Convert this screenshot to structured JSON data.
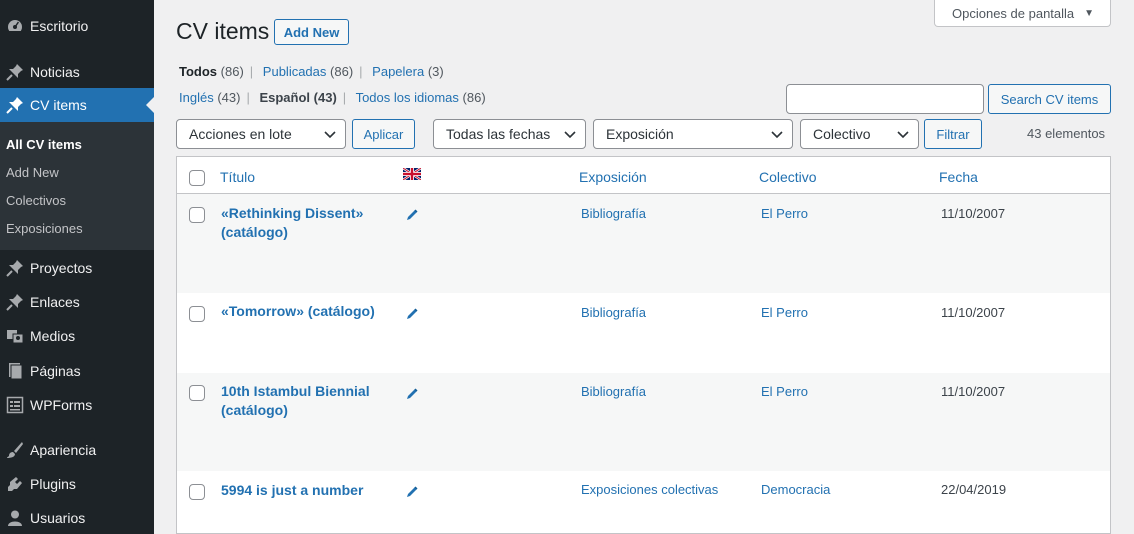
{
  "sidebar": {
    "items": [
      {
        "label": "Escritorio",
        "icon": "dashboard-icon"
      },
      {
        "label": "Noticias",
        "icon": "pin-icon"
      },
      {
        "label": "CV items",
        "icon": "pin-icon"
      },
      {
        "label": "Proyectos",
        "icon": "pin-icon"
      },
      {
        "label": "Enlaces",
        "icon": "pin-icon"
      },
      {
        "label": "Medios",
        "icon": "media-icon"
      },
      {
        "label": "Páginas",
        "icon": "pages-icon"
      },
      {
        "label": "WPForms",
        "icon": "forms-icon"
      },
      {
        "label": "Apariencia",
        "icon": "brush-icon"
      },
      {
        "label": "Plugins",
        "icon": "plugin-icon"
      },
      {
        "label": "Usuarios",
        "icon": "user-icon"
      }
    ],
    "submenu": [
      "All CV items",
      "Add New",
      "Colectivos",
      "Exposiciones"
    ]
  },
  "header": {
    "title": "CV items",
    "add_new": "Add New",
    "screen_options": "Opciones de pantalla"
  },
  "status_filters": [
    {
      "label": "Todos",
      "count": "(86)"
    },
    {
      "label": "Publicadas",
      "count": "(86)"
    },
    {
      "label": "Papelera",
      "count": "(3)"
    }
  ],
  "language_filters": [
    {
      "label": "Inglés",
      "count": "(43)"
    },
    {
      "label": "Español",
      "count": "(43)"
    },
    {
      "label": "Todos los idiomas",
      "count": "(86)"
    }
  ],
  "search": {
    "value": "",
    "button": "Search CV items"
  },
  "bulk": {
    "selected": "Acciones en lote",
    "apply": "Aplicar"
  },
  "filters": {
    "dates": "Todas las fechas",
    "exposicion": "Exposición",
    "colectivo": "Colectivo",
    "button": "Filtrar"
  },
  "items_count": "43 elementos",
  "table": {
    "columns": {
      "title": "Título",
      "exposicion": "Exposición",
      "colectivo": "Colectivo",
      "fecha": "Fecha"
    },
    "rows": [
      {
        "title": "«Rethinking Dissent» (catálogo)",
        "exposicion": "Bibliografía",
        "colectivo": "El Perro",
        "fecha": "11/10/2007"
      },
      {
        "title": "«Tomorrow» (catálogo)",
        "exposicion": "Bibliografía",
        "colectivo": "El Perro",
        "fecha": "11/10/2007"
      },
      {
        "title": "10th Istambul Biennial (catálogo)",
        "exposicion": "Bibliografía",
        "colectivo": "El Perro",
        "fecha": "11/10/2007"
      },
      {
        "title": "5994 is just a number",
        "exposicion": "Exposiciones colectivas",
        "colectivo": "Democracia",
        "fecha": "22/04/2019"
      }
    ]
  },
  "colors": {
    "sidebar": "#1d2327",
    "accent": "#2271b1",
    "submenu": "#2c3338"
  }
}
